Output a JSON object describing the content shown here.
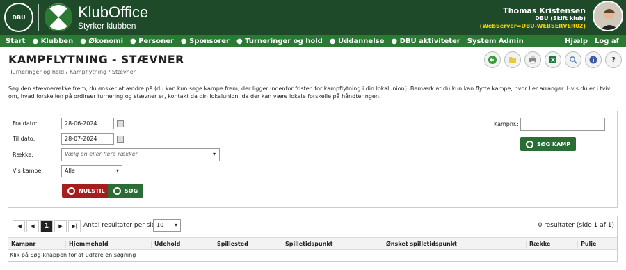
{
  "header": {
    "seal_text": "DBU",
    "brand_title": "KlubOffice",
    "brand_tagline": "Styrker klubben",
    "user_name": "Thomas Kristensen",
    "user_club": "DBU (Skift klub)",
    "user_server": "(WebServer=DBU-WEBSERVER02)"
  },
  "nav": {
    "items": [
      "Start",
      "Klubben",
      "Økonomi",
      "Personer",
      "Sponsorer",
      "Turneringer og hold",
      "Uddannelse",
      "DBU aktiviteter",
      "System Admin"
    ],
    "help": "Hjælp",
    "logout": "Log af"
  },
  "page": {
    "title": "KAMPFLYTNING - STÆVNER",
    "breadcrumb": "Turneringer og hold / Kampflytning / Stævner",
    "description": "Søg den stævnerække frem, du ønsker at ændre på (du kan kun søge kampe frem, der ligger indenfor fristen for kampflytning i din lokalunion). Bemærk at du kun kan flytte kampe, hvor I er arrangør. Hvis du er i tvivl om, hvad forskellen på ordinær turnering og stævner er, kontakt da din lokalunion, da der kan være lokale forskelle på håndteringen."
  },
  "toolbar": {
    "icons": [
      "back-icon",
      "folder-icon",
      "print-icon",
      "excel-icon",
      "search-icon",
      "info-icon",
      "help-icon"
    ],
    "help_glyph": "?"
  },
  "form": {
    "from_label": "Fra dato:",
    "from_value": "28-06-2024",
    "to_label": "Til dato:",
    "to_value": "28-07-2024",
    "row_label": "Række:",
    "row_placeholder": "Vælg en eller flere rækker",
    "show_label": "Vis kampe:",
    "show_value": "Alle",
    "reset_label": "NULSTIL",
    "search_label": "SØG",
    "matchno_label": "Kampnr.:",
    "matchno_value": "",
    "search_match_label": "SØG KAMP"
  },
  "results": {
    "current_page": "1",
    "per_page_label": "Antal resultater per side",
    "per_page_value": "10",
    "count_text": "0 resultater (side 1 af 1)",
    "columns": [
      "Kampnr",
      "Hjemmehold",
      "Udehold",
      "Spillested",
      "Spilletidspunkt",
      "Ønsket spilletidspunkt",
      "Række",
      "Pulje"
    ],
    "empty_text": "Klik på Søg-knappen for at udføre en søgning"
  },
  "colors": {
    "header_bg": "#1e4a2a",
    "nav_bg": "#2a7a34",
    "danger": "#a51d1d",
    "primary": "#2a6e35",
    "server_text": "#f5d000"
  }
}
